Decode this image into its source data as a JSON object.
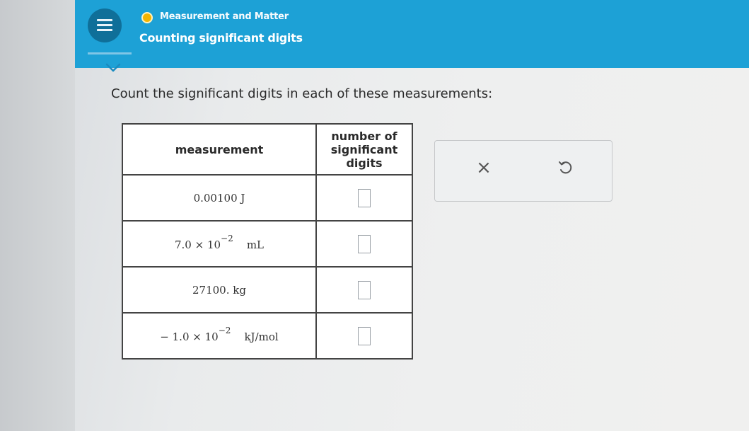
{
  "header": {
    "topic": "Measurement and Matter",
    "title": "Counting significant digits",
    "accent_color": "#1da1d6",
    "menu_icon": "hamburger-icon",
    "collapse_icon": "chevron-down-icon"
  },
  "question": {
    "prompt": "Count the significant digits in each of these measurements:"
  },
  "table": {
    "headers": {
      "measurement": "measurement",
      "digits_line1": "number of",
      "digits_line2": "significant",
      "digits_line3": "digits"
    },
    "rows": [
      {
        "value": "0.00100",
        "power": "",
        "unit": "J",
        "answer": ""
      },
      {
        "value": "7.0 × 10",
        "power": "−2",
        "unit": "mL",
        "answer": ""
      },
      {
        "value": "27100.",
        "power": "",
        "unit": "kg",
        "answer": ""
      },
      {
        "value": "− 1.0 × 10",
        "power": "−2",
        "unit": "kJ/mol",
        "answer": ""
      }
    ]
  },
  "tools": {
    "clear_symbol": "×",
    "clear_icon": "close-icon",
    "undo_icon": "undo-icon"
  }
}
